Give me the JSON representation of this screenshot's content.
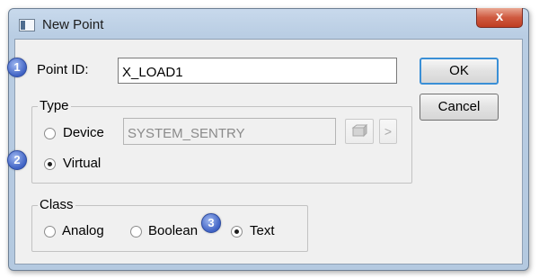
{
  "window": {
    "title": "New Point",
    "close_glyph": "x"
  },
  "point_id": {
    "label": "Point ID:",
    "value": "X_LOAD1"
  },
  "buttons": {
    "ok": "OK",
    "cancel": "Cancel"
  },
  "type_group": {
    "title": "Type",
    "device_label": "Device",
    "device_value": "SYSTEM_SENTRY",
    "virtual_label": "Virtual",
    "selected": "Virtual",
    "browse_icon": "browse-icon",
    "next_glyph": ">"
  },
  "class_group": {
    "title": "Class",
    "analog_label": "Analog",
    "boolean_label": "Boolean",
    "text_label": "Text",
    "selected": "Text"
  },
  "callouts": [
    "1",
    "2",
    "3"
  ],
  "colors": {
    "close_button": "#c94a30",
    "callout": "#3f62c4",
    "default_button_border": "#3a8fd6"
  }
}
